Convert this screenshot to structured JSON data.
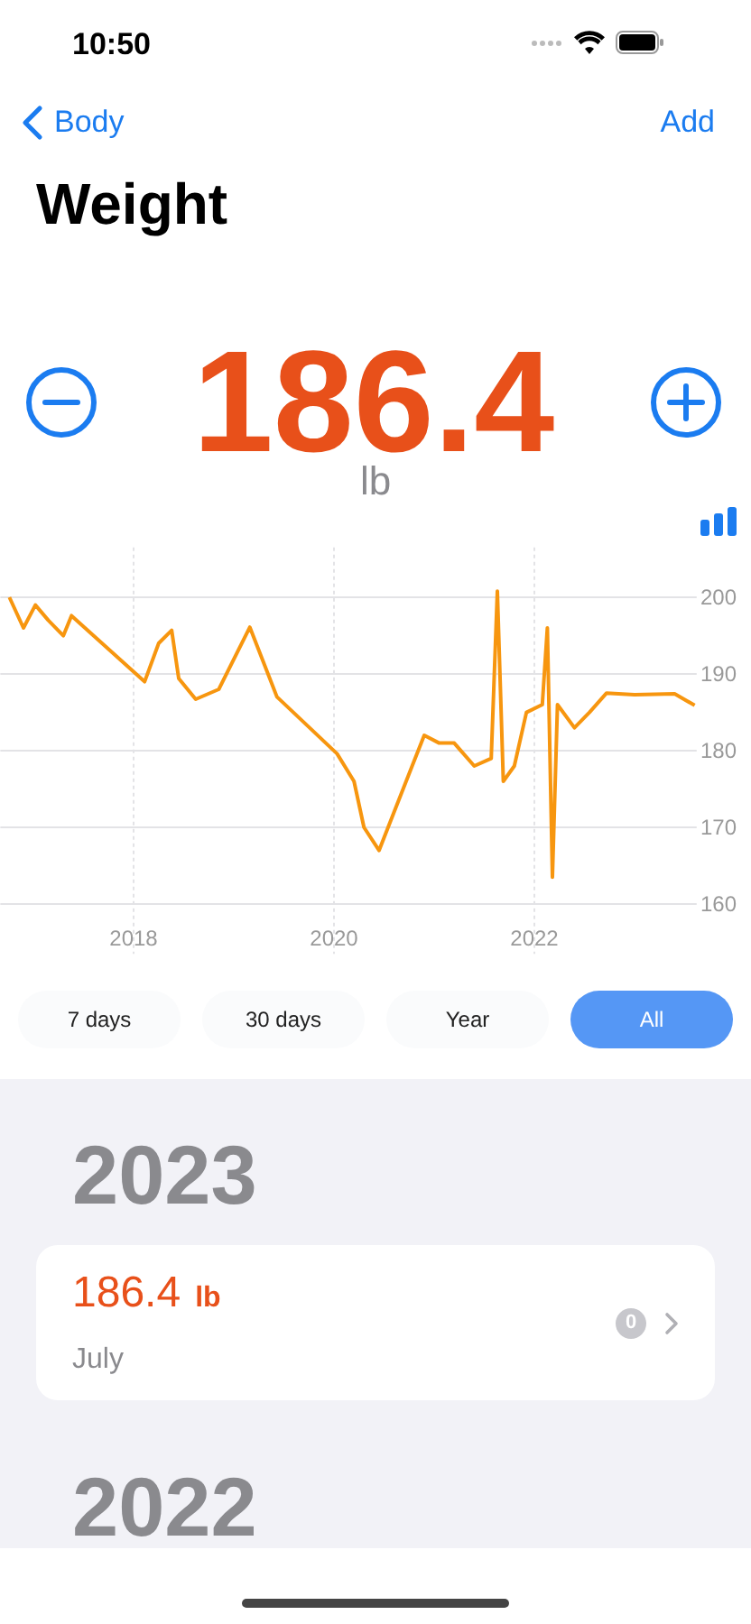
{
  "status_bar": {
    "time": "10:50"
  },
  "nav": {
    "back": "Body",
    "action": "Add"
  },
  "title": "Weight",
  "current": {
    "value": "186.4",
    "unit": "lb"
  },
  "chart": {
    "chart_data": {
      "type": "line",
      "grid": true,
      "xlim": [
        2016.67,
        2023.62
      ],
      "ylim": [
        153.5,
        206.5
      ],
      "x": [
        2016.76,
        2016.9,
        2017.02,
        2017.15,
        2017.3,
        2017.38,
        2018.11,
        2018.25,
        2018.38,
        2018.45,
        2018.62,
        2018.85,
        2019.16,
        2019.43,
        2020.03,
        2020.2,
        2020.3,
        2020.45,
        2020.6,
        2020.78,
        2020.9,
        2021.05,
        2021.2,
        2021.4,
        2021.57,
        2021.63,
        2021.69,
        2021.8,
        2021.92,
        2022.08,
        2022.13,
        2022.18,
        2022.23,
        2022.4,
        2022.55,
        2022.72,
        2023.0,
        2023.4,
        2023.6
      ],
      "series": [
        {
          "color": "#f7960f",
          "values": [
            200,
            196,
            199,
            197,
            195,
            197.6,
            189,
            194,
            195.7,
            189.4,
            186.7,
            188,
            196.1,
            187,
            179.6,
            176,
            170,
            167,
            172,
            178,
            182,
            181,
            181,
            178,
            179,
            200.8,
            176,
            178,
            185,
            186,
            196,
            163.5,
            186,
            183,
            185,
            187.5,
            187.3,
            187.4,
            185.9
          ]
        }
      ],
      "xticks": [
        {
          "value": 2018,
          "label": "2018"
        },
        {
          "value": 2020,
          "label": "2020"
        },
        {
          "value": 2022,
          "label": "2022"
        }
      ],
      "yticks": [
        160,
        170,
        180,
        190,
        200
      ]
    }
  },
  "ranges": [
    {
      "label": "7 days",
      "selected": false
    },
    {
      "label": "30 days",
      "selected": false
    },
    {
      "label": "Year",
      "selected": false
    },
    {
      "label": "All",
      "selected": true
    }
  ],
  "history": [
    {
      "year": "2023",
      "entries": [
        {
          "value": "186.4",
          "unit": "lb",
          "month": "July",
          "badge": "0"
        }
      ]
    },
    {
      "year": "2022"
    }
  ]
}
